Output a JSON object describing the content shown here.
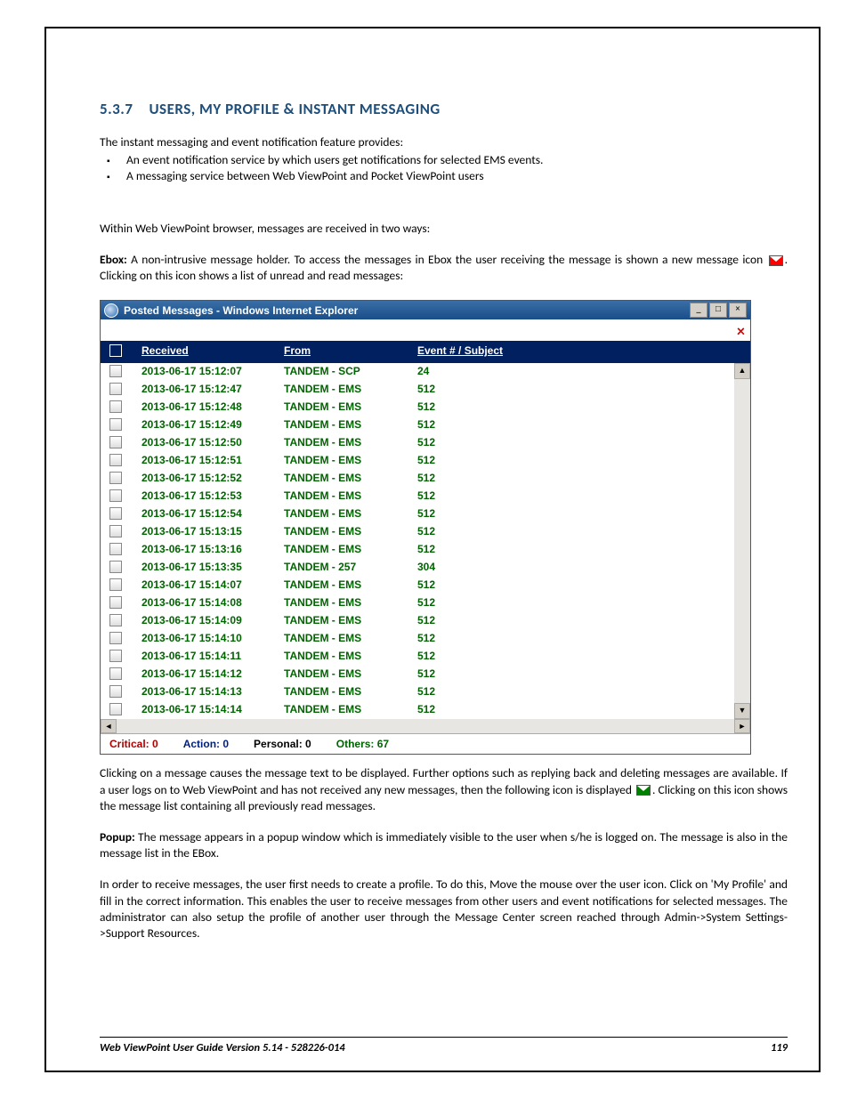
{
  "heading": {
    "number": "5.3.7",
    "text": "USERS, MY PROFILE & INSTANT MESSAGING"
  },
  "intro": "The instant messaging and event notification feature provides:",
  "bullets": [
    "An event notification service by which users get notifications for selected EMS events.",
    "A messaging service between Web ViewPoint and Pocket ViewPoint users"
  ],
  "para_within": "Within Web ViewPoint browser, messages are received in two ways:",
  "ebox_label": "Ebox:",
  "ebox_text_a": " A non-intrusive message holder. To access the messages in Ebox the user receiving the message is shown a new message icon ",
  "ebox_text_b": ". Clicking on this icon shows a list of unread and read messages:",
  "window": {
    "title": "Posted Messages - Windows Internet Explorer",
    "headers": {
      "received": "Received",
      "from": "From",
      "subject": "Event # / Subject"
    },
    "rows": [
      {
        "received": "2013-06-17 15:12:07",
        "from": "TANDEM - SCP",
        "subject": "24"
      },
      {
        "received": "2013-06-17 15:12:47",
        "from": "TANDEM - EMS",
        "subject": "512"
      },
      {
        "received": "2013-06-17 15:12:48",
        "from": "TANDEM - EMS",
        "subject": "512"
      },
      {
        "received": "2013-06-17 15:12:49",
        "from": "TANDEM - EMS",
        "subject": "512"
      },
      {
        "received": "2013-06-17 15:12:50",
        "from": "TANDEM - EMS",
        "subject": "512"
      },
      {
        "received": "2013-06-17 15:12:51",
        "from": "TANDEM - EMS",
        "subject": "512"
      },
      {
        "received": "2013-06-17 15:12:52",
        "from": "TANDEM - EMS",
        "subject": "512"
      },
      {
        "received": "2013-06-17 15:12:53",
        "from": "TANDEM - EMS",
        "subject": "512"
      },
      {
        "received": "2013-06-17 15:12:54",
        "from": "TANDEM - EMS",
        "subject": "512"
      },
      {
        "received": "2013-06-17 15:13:15",
        "from": "TANDEM - EMS",
        "subject": "512"
      },
      {
        "received": "2013-06-17 15:13:16",
        "from": "TANDEM - EMS",
        "subject": "512"
      },
      {
        "received": "2013-06-17 15:13:35",
        "from": "TANDEM - 257",
        "subject": "304"
      },
      {
        "received": "2013-06-17 15:14:07",
        "from": "TANDEM - EMS",
        "subject": "512"
      },
      {
        "received": "2013-06-17 15:14:08",
        "from": "TANDEM - EMS",
        "subject": "512"
      },
      {
        "received": "2013-06-17 15:14:09",
        "from": "TANDEM - EMS",
        "subject": "512"
      },
      {
        "received": "2013-06-17 15:14:10",
        "from": "TANDEM - EMS",
        "subject": "512"
      },
      {
        "received": "2013-06-17 15:14:11",
        "from": "TANDEM - EMS",
        "subject": "512"
      },
      {
        "received": "2013-06-17 15:14:12",
        "from": "TANDEM - EMS",
        "subject": "512"
      },
      {
        "received": "2013-06-17 15:14:13",
        "from": "TANDEM - EMS",
        "subject": "512"
      },
      {
        "received": "2013-06-17 15:14:14",
        "from": "TANDEM - EMS",
        "subject": "512"
      }
    ],
    "status": {
      "critical": "Critical: 0",
      "action": "Action: 0",
      "personal": "Personal: 0",
      "others": "Others: 67"
    }
  },
  "para_click_a": "Clicking on a message causes the message text to be displayed. Further options such as replying back and deleting messages are available. If a user logs on to Web ViewPoint and has not received any new messages, then the following icon is displayed  ",
  "para_click_b": ". Clicking on this icon shows the message list containing all previously read messages.",
  "popup_label": "Popup:",
  "popup_text": " The message appears in a popup window which is immediately visible to the user when s/he is logged on. The message is also in the message list in the EBox.",
  "para_profile": "In order to receive messages, the user first needs to create a profile. To do this, Move the mouse over the user icon. Click on 'My Profile' and fill in the correct information. This enables the user to receive messages from other users and event notifications for selected messages. The administrator can also setup the profile of another user through the Message Center screen reached through Admin->System Settings->Support Resources.",
  "footer": {
    "left": "Web ViewPoint User Guide Version 5.14 - 528226-014",
    "right": "119"
  }
}
